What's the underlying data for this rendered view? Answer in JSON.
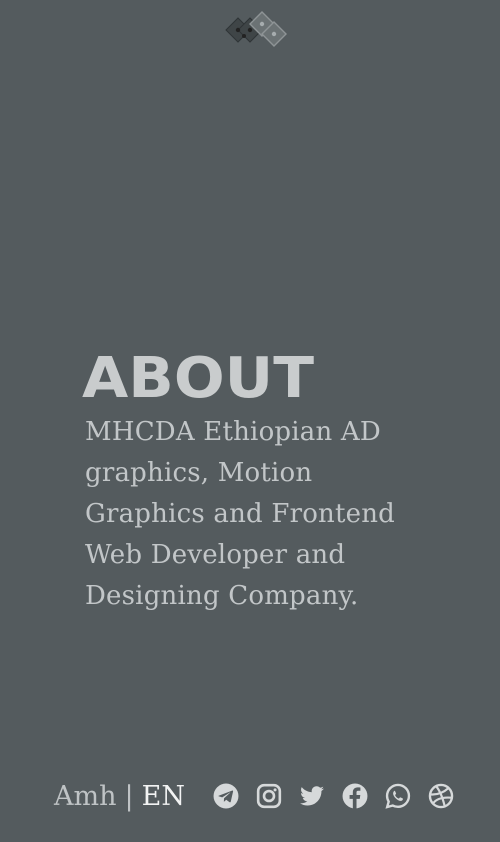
{
  "header": {
    "logo_icon": "mhcda-diamond-logo-icon"
  },
  "about": {
    "title": "ABOUT",
    "description": "MHCDA Ethiopian AD graphics, Motion Graphics and Frontend Web Developer and Designing Company."
  },
  "footer": {
    "language": {
      "amharic_label": "Amh",
      "separator": "|",
      "english_label": "EN",
      "selected": "EN"
    },
    "social_links": [
      {
        "icon": "telegram-icon"
      },
      {
        "icon": "instagram-icon"
      },
      {
        "icon": "twitter-icon"
      },
      {
        "icon": "facebook-icon"
      },
      {
        "icon": "whatsapp-icon"
      },
      {
        "icon": "dribbble-icon"
      }
    ]
  },
  "colors": {
    "background": "#545b5e",
    "text": "#c2c6c8",
    "active_language": "#f2f3f3",
    "icon": "#d6d9da"
  }
}
